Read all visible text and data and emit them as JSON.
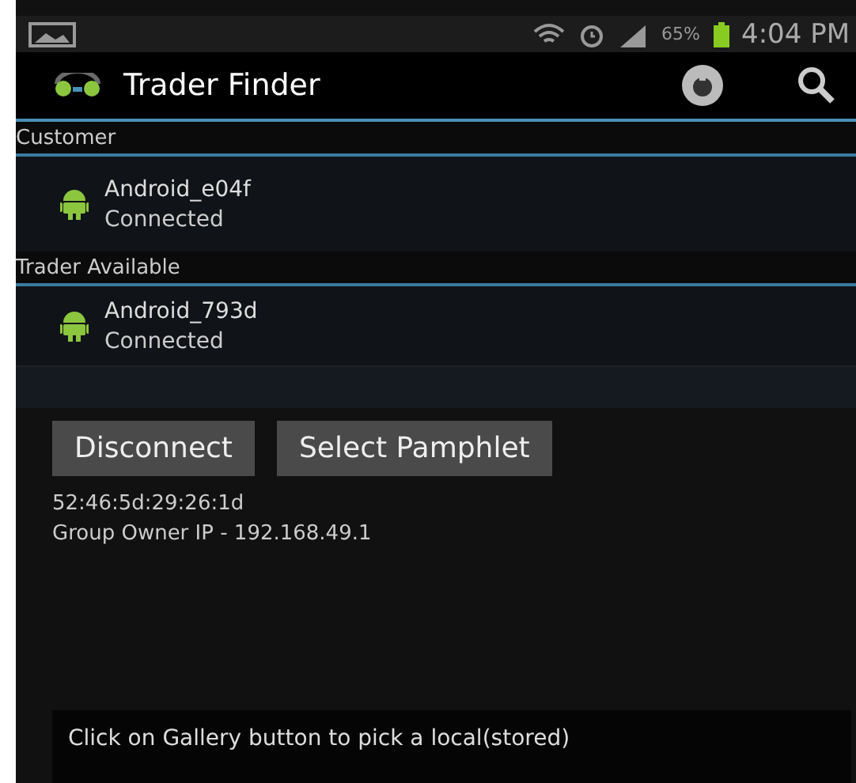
{
  "status_bar": {
    "battery": "65%",
    "time": "4:04 PM"
  },
  "action_bar": {
    "title": "Trader Finder"
  },
  "sections": [
    {
      "header": "Customer",
      "devices": [
        {
          "name": "Android_e04f",
          "status": "Connected"
        }
      ]
    },
    {
      "header": "Trader Available",
      "devices": [
        {
          "name": "Android_793d",
          "status": "Connected"
        }
      ]
    }
  ],
  "buttons": [
    "Disconnect",
    "Select Pamphlet"
  ],
  "info": [
    "52:46:5d:29:26:1d",
    "Group Owner IP - 192.168.49.1"
  ],
  "hint": "Click on Gallery button to pick a local(stored)"
}
